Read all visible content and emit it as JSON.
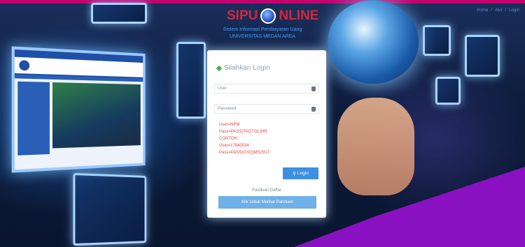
{
  "brand": {
    "prefix": "SIPU",
    "suffix": "NLINE"
  },
  "subtitle": {
    "line1": "Sistem Informasi Pembayaran Uang",
    "line2": "UNIVERSITAS MEDAN AREA"
  },
  "top_links": [
    "Home",
    "/",
    "Alur",
    "/",
    "Login"
  ],
  "login": {
    "title": "Silahkan Login",
    "user_placeholder": "User",
    "password_placeholder": "Password",
    "hints": [
      "User=NPM",
      "Pass=PASS(TAGTGL)HR",
      "CONTOH :",
      "User=17840034",
      "Pass=PASS(GSQ)MS2917"
    ],
    "login_button": "Login",
    "panduan_label": "Panduan Daftar",
    "panduan_button": "Klik Untuk Melihat Panduan"
  },
  "colors": {
    "accent": "#c3006e",
    "brand_red": "#d6263b",
    "button_blue": "#3d8fe0",
    "hint_red": "#e8443b",
    "wedge_purple": "#8a11c2"
  }
}
